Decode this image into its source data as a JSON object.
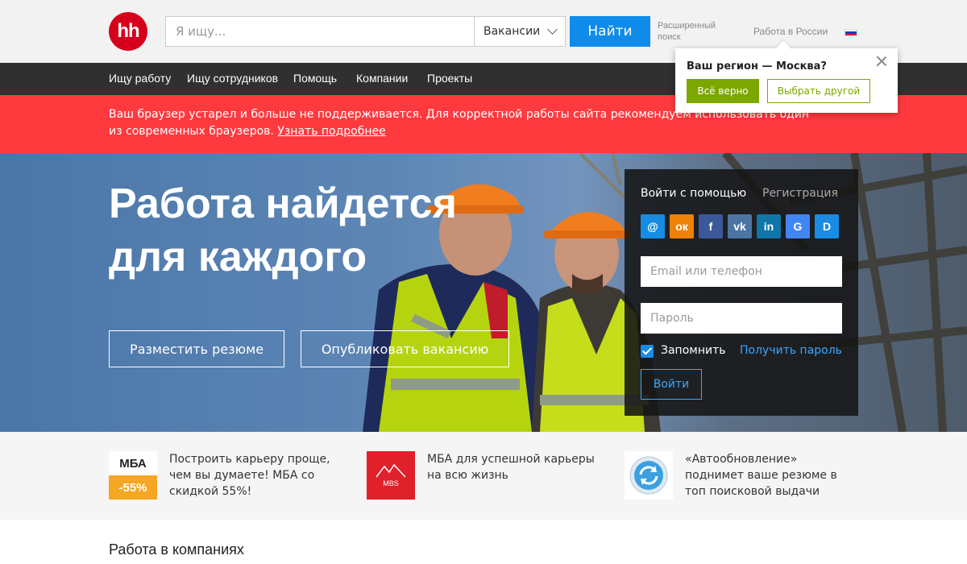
{
  "header": {
    "logo": "hh",
    "search_placeholder": "Я ищу...",
    "search_type": "Вакансии",
    "find_label": "Найти",
    "advanced_search": "Расширенный поиск",
    "region_link": "Работа в России"
  },
  "nav": {
    "items": [
      "Ищу работу",
      "Ищу сотрудников",
      "Помощь",
      "Компании",
      "Проекты"
    ]
  },
  "region_popup": {
    "title": "Ваш регион — Москва?",
    "confirm": "Всё верно",
    "choose_other": "Выбрать другой"
  },
  "warning": {
    "text": "Ваш браузер устарел и больше не поддерживается. Для корректной работы сайта рекомендуем использовать один из современных браузеров.",
    "link": "Узнать подробнее"
  },
  "hero": {
    "title_line1": "Работа найдется",
    "title_line2": "для каждого",
    "post_resume": "Разместить резюме",
    "post_vacancy": "Опубликовать вакансию"
  },
  "login": {
    "tab_login": "Войти с помощью",
    "tab_register": "Регистрация",
    "social": [
      {
        "name": "mail-ru-icon",
        "glyph": "@",
        "color": "#168de2"
      },
      {
        "name": "odnoklassniki-icon",
        "glyph": "ок",
        "color": "#ee8208"
      },
      {
        "name": "facebook-icon",
        "glyph": "f",
        "color": "#3b5998"
      },
      {
        "name": "vkontakte-icon",
        "glyph": "vk",
        "color": "#4c75a3"
      },
      {
        "name": "linkedin-icon",
        "glyph": "in",
        "color": "#0e76a8"
      },
      {
        "name": "google-icon",
        "glyph": "G",
        "color": "#4285f4"
      },
      {
        "name": "dnevnik-icon",
        "glyph": "D",
        "color": "#1a8ce3"
      }
    ],
    "email_placeholder": "Email или телефон",
    "password_placeholder": "Пароль",
    "remember": "Запомнить",
    "forgot": "Получить пароль",
    "submit": "Войти"
  },
  "promos": [
    {
      "badge_top": "МБА",
      "badge_bottom": "-55%",
      "text": "Построить карьеру проще, чем вы думаете! МБА со скидкой 55%!"
    },
    {
      "badge": "MBS",
      "text": "МБА для успешной карьеры на всю жизнь"
    },
    {
      "text": "«Автообновление» поднимет ваше резюме в топ поисковой выдачи"
    }
  ],
  "section_title": "Работа в компаниях",
  "colors": {
    "brand_red": "#d6001c",
    "accent_blue": "#0f8bea",
    "warning_red": "#ff3a3f",
    "confirm_green": "#7ca700"
  }
}
